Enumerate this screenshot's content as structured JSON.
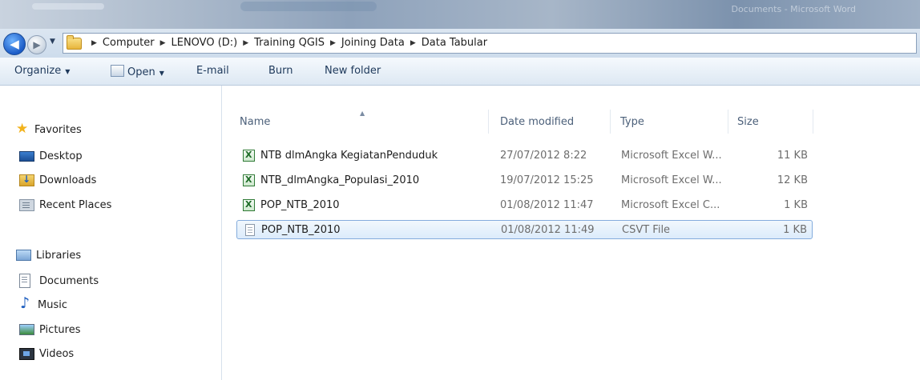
{
  "window": {
    "title": "Documents - Microsoft Word"
  },
  "address_bar": {
    "breadcrumbs": [
      "Computer",
      "LENOVO (D:)",
      "Training QGIS",
      "Joining Data",
      "Data Tabular"
    ]
  },
  "toolbar": {
    "organize_label": "Organize",
    "open_label": "Open",
    "email_label": "E-mail",
    "burn_label": "Burn",
    "new_folder_label": "New folder"
  },
  "navigation": {
    "favorites": {
      "label": "Favorites",
      "items": [
        {
          "label": "Desktop",
          "icon": "desktop-icon"
        },
        {
          "label": "Downloads",
          "icon": "downloads-icon"
        },
        {
          "label": "Recent Places",
          "icon": "recent-places-icon"
        }
      ]
    },
    "libraries": {
      "label": "Libraries",
      "items": [
        {
          "label": "Documents",
          "icon": "documents-icon"
        },
        {
          "label": "Music",
          "icon": "music-icon"
        },
        {
          "label": "Pictures",
          "icon": "pictures-icon"
        },
        {
          "label": "Videos",
          "icon": "videos-icon"
        }
      ]
    }
  },
  "file_list": {
    "columns": {
      "name": "Name",
      "date": "Date modified",
      "type": "Type",
      "size": "Size"
    },
    "sorted_by": "Name",
    "files": [
      {
        "name": "NTB dlmAngka KegiatanPenduduk",
        "date": "27/07/2012 8:22",
        "type": "Microsoft Excel W...",
        "size": "11 KB",
        "icon": "excel-icon",
        "selected": false
      },
      {
        "name": "NTB_dlmAngka_Populasi_2010",
        "date": "19/07/2012 15:25",
        "type": "Microsoft Excel W...",
        "size": "12 KB",
        "icon": "excel-icon",
        "selected": false
      },
      {
        "name": "POP_NTB_2010",
        "date": "01/08/2012 11:47",
        "type": "Microsoft Excel C...",
        "size": "1 KB",
        "icon": "excel-icon",
        "selected": false
      },
      {
        "name": "POP_NTB_2010",
        "date": "01/08/2012 11:49",
        "type": "CSVT File",
        "size": "1 KB",
        "icon": "file-icon",
        "selected": true
      }
    ]
  },
  "colors": {
    "selection_border": "#84acdd",
    "toolbar_text": "#1e395b",
    "header_text": "#4c607a",
    "folder_yellow": "#e7b53c"
  }
}
